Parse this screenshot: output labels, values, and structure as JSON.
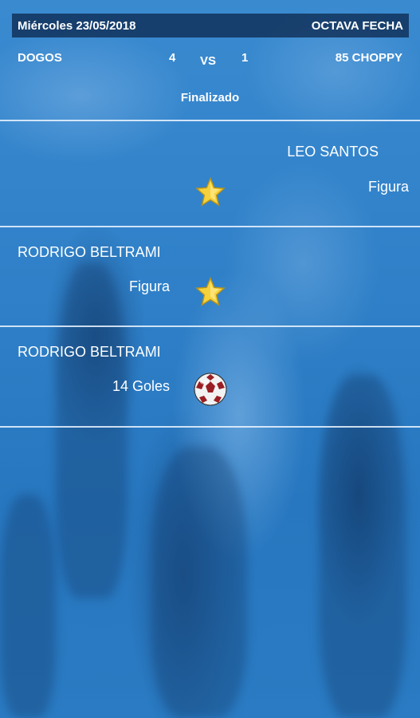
{
  "header": {
    "date": "Miércoles 23/05/2018",
    "round": "OCTAVA FECHA"
  },
  "match": {
    "home_team": "DOGOS",
    "home_score": "4",
    "vs": "VS",
    "away_score": "1",
    "away_team": "85 CHOPPY",
    "status": "Finalizado"
  },
  "events": [
    {
      "side": "away",
      "player": "LEO SANTOS",
      "detail": "Figura",
      "icon": "star-icon"
    },
    {
      "side": "home",
      "player": "RODRIGO BELTRAMI",
      "detail": "Figura",
      "icon": "star-icon"
    },
    {
      "side": "home",
      "player": "RODRIGO BELTRAMI",
      "detail": "14 Goles",
      "icon": "soccer-ball-icon"
    }
  ],
  "colors": {
    "background": "#2b7cc4",
    "header_bar": "#0a2346",
    "star": "#f5d23c",
    "ball_red": "#9a1f24"
  }
}
